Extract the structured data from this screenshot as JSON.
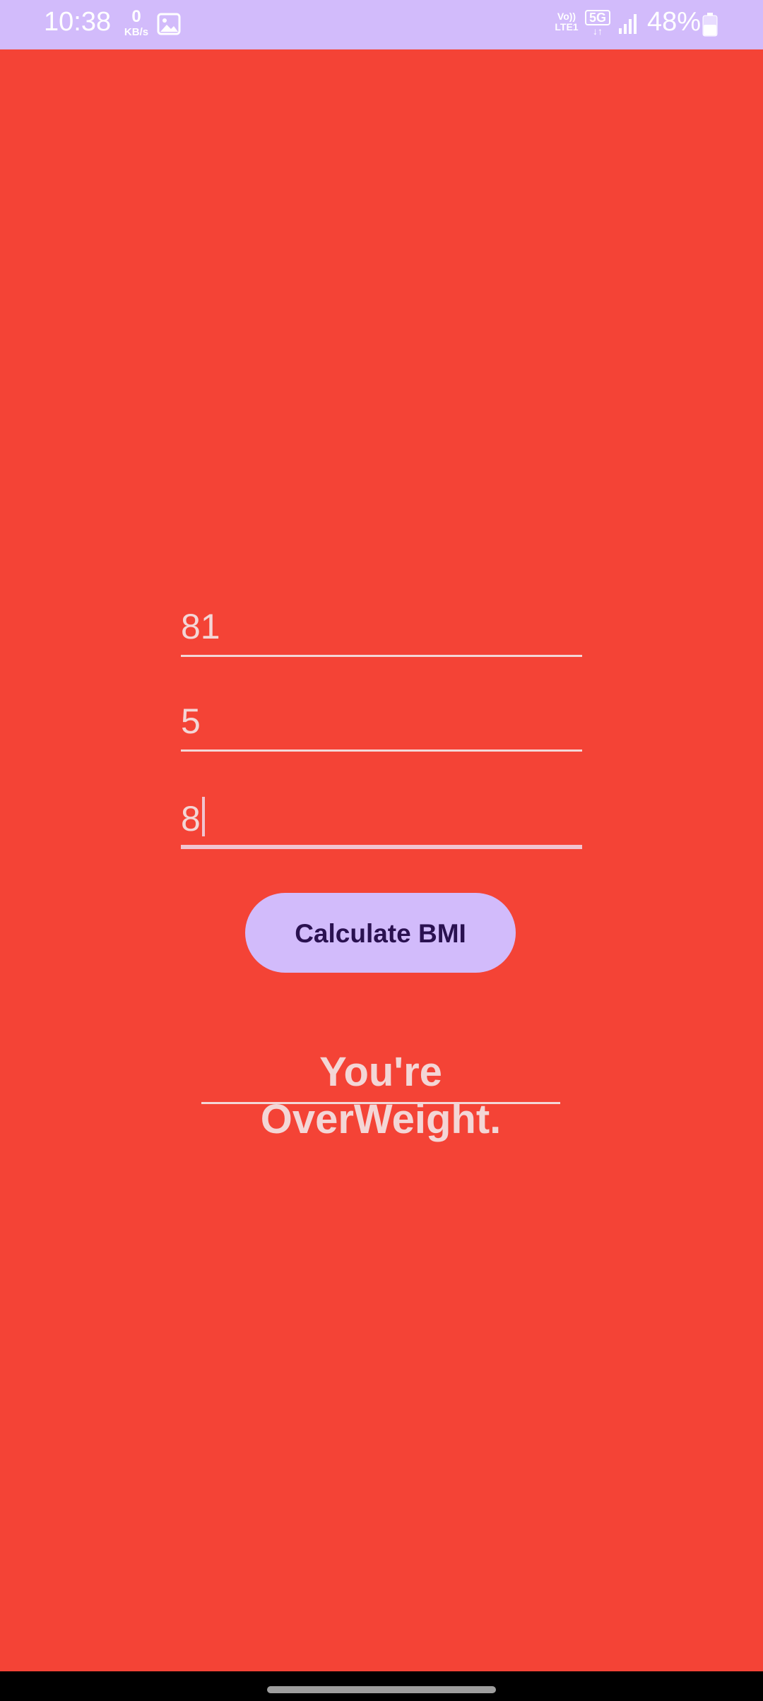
{
  "status_bar": {
    "time": "10:38",
    "net_speed_value": "0",
    "net_speed_unit": "KB/s",
    "volte_top": "Vo))",
    "volte_bottom": "LTE1",
    "network_type": "5G",
    "network_arrows": "↓↑",
    "battery_percent": "48%",
    "icons": [
      "gallery-icon",
      "signal-icon",
      "battery-icon"
    ]
  },
  "form": {
    "weight_value": "81",
    "height_feet_value": "5",
    "height_inches_value": "8",
    "calculate_label": "Calculate BMI"
  },
  "result": {
    "message": "You're OverWeight."
  },
  "colors": {
    "background": "#f44336",
    "status_bar": "#d2bbfb",
    "button": "#d2bbfb",
    "button_text": "#2a1150",
    "input_text": "#f3d6d6"
  }
}
